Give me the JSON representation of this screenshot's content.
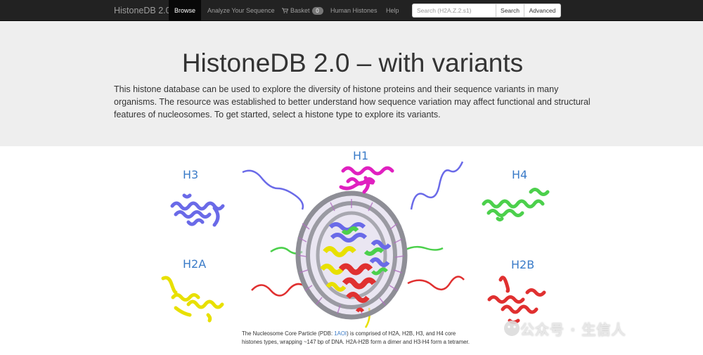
{
  "navbar": {
    "brand": "HistoneDB 2.0",
    "items": [
      {
        "label": "Browse"
      },
      {
        "label": "Analyze Your Sequence"
      },
      {
        "label": "Basket",
        "count": "0"
      },
      {
        "label": "Human Histones"
      },
      {
        "label": "Help"
      }
    ],
    "search": {
      "placeholder": "Search (H2A.Z.2.s1)",
      "value": ""
    },
    "search_button": "Search",
    "advanced_button": "Advanced"
  },
  "jumbotron": {
    "title": "HistoneDB 2.0 – with variants",
    "lead": "This histone database can be used to explore the diversity of histone proteins and their sequence variants in many organisms. The resource was established to better understand how sequence variation may affect functional and structural features of nucleosomes. To get started, select a histone type to explore its variants."
  },
  "figure": {
    "labels": {
      "h1": "H1",
      "h3": "H3",
      "h4": "H4",
      "h2a": "H2A",
      "h2b": "H2B"
    },
    "colors": {
      "h1": "#e020c0",
      "h3": "#6a6ae8",
      "h4": "#4cd04c",
      "h2a": "#e8e000",
      "h2b": "#e03030",
      "dna": "#8e8e96",
      "label": "#3a7bc8"
    },
    "caption": {
      "before": "The Nucleosome Core Particle (PDB: ",
      "link": "1AOI",
      "after": ") is comprised of H2A, H2B, H3, and H4 core histones types, wrapping ~147 bp of DNA. H2A-H2B form a dimer and H3-H4 form a tetramer."
    },
    "watermark": "公众号 · 生信人"
  }
}
